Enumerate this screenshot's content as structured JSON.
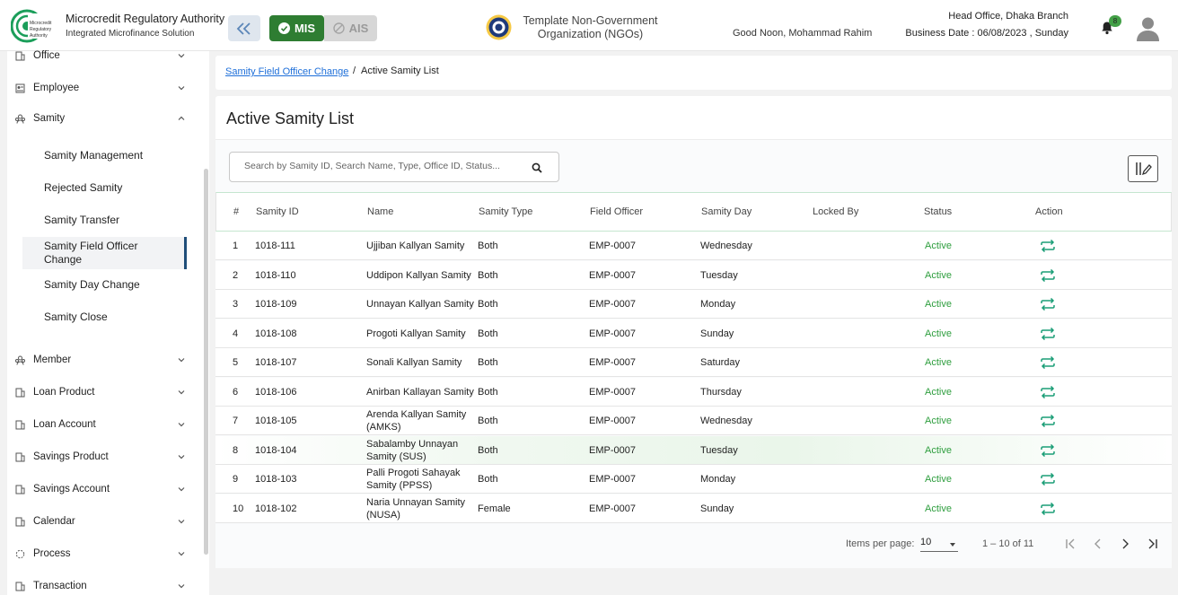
{
  "header": {
    "app_title": "Microcredit Regulatory Authority",
    "app_subtitle": "Integrated Microfinance Solution",
    "mis_label": "MIS",
    "ais_label": "AIS",
    "org_name": "Template Non-Government Organization (NGOs)",
    "greeting": "Good Noon, Mohammad Rahim",
    "branch": "Head Office, Dhaka Branch",
    "business_date": "Business Date : 06/08/2023 , Sunday",
    "notification_count": "8"
  },
  "sidebar": {
    "items": [
      {
        "label": "Office",
        "icon": "office-icon"
      },
      {
        "label": "Employee",
        "icon": "employee-icon"
      },
      {
        "label": "Samity",
        "icon": "samity-icon",
        "expanded": true
      },
      {
        "label": "Member",
        "icon": "member-icon"
      },
      {
        "label": "Loan Product",
        "icon": "loan-product-icon"
      },
      {
        "label": "Loan Account",
        "icon": "loan-account-icon"
      },
      {
        "label": "Savings Product",
        "icon": "savings-product-icon"
      },
      {
        "label": "Savings Account",
        "icon": "savings-account-icon"
      },
      {
        "label": "Calendar",
        "icon": "calendar-icon"
      },
      {
        "label": "Process",
        "icon": "process-icon"
      },
      {
        "label": "Transaction",
        "icon": "transaction-icon"
      }
    ],
    "samity_sub": [
      {
        "label": "Samity Management"
      },
      {
        "label": "Rejected Samity"
      },
      {
        "label": "Samity Transfer"
      },
      {
        "label": "Samity Field Officer Change",
        "active": true
      },
      {
        "label": "Samity Day Change"
      },
      {
        "label": "Samity Close"
      }
    ]
  },
  "breadcrumb": {
    "link": "Samity Field Officer Change",
    "separator": "/",
    "current": "Active Samity List"
  },
  "page": {
    "title": "Active Samity List",
    "search_placeholder": "Search by Samity ID, Search Name, Type, Office ID, Status..."
  },
  "table": {
    "headers": [
      "#",
      "Samity ID",
      "Name",
      "Samity Type",
      "Field Officer",
      "Samity Day",
      "Locked By",
      "Status",
      "Action"
    ],
    "rows": [
      {
        "n": "1",
        "id": "1018-111",
        "name": "Ujjiban Kallyan Samity",
        "type": "Both",
        "officer": "EMP-0007",
        "day": "Wednesday",
        "locked": "",
        "status": "Active"
      },
      {
        "n": "2",
        "id": "1018-110",
        "name": "Uddipon Kallyan Samity",
        "type": "Both",
        "officer": "EMP-0007",
        "day": "Tuesday",
        "locked": "",
        "status": "Active"
      },
      {
        "n": "3",
        "id": "1018-109",
        "name": "Unnayan Kallyan Samity",
        "type": "Both",
        "officer": "EMP-0007",
        "day": "Monday",
        "locked": "",
        "status": "Active"
      },
      {
        "n": "4",
        "id": "1018-108",
        "name": "Progoti Kallyan Samity",
        "type": "Both",
        "officer": "EMP-0007",
        "day": "Sunday",
        "locked": "",
        "status": "Active"
      },
      {
        "n": "5",
        "id": "1018-107",
        "name": "Sonali Kallyan Samity",
        "type": "Both",
        "officer": "EMP-0007",
        "day": "Saturday",
        "locked": "",
        "status": "Active"
      },
      {
        "n": "6",
        "id": "1018-106",
        "name": "Anirban Kallayan Samity",
        "type": "Both",
        "officer": "EMP-0007",
        "day": "Thursday",
        "locked": "",
        "status": "Active"
      },
      {
        "n": "7",
        "id": "1018-105",
        "name": "Arenda Kallyan Samity (AMKS)",
        "type": "Both",
        "officer": "EMP-0007",
        "day": "Wednesday",
        "locked": "",
        "status": "Active"
      },
      {
        "n": "8",
        "id": "1018-104",
        "name": "Sabalamby Unnayan Samity (SUS)",
        "type": "Both",
        "officer": "EMP-0007",
        "day": "Tuesday",
        "locked": "",
        "status": "Active"
      },
      {
        "n": "9",
        "id": "1018-103",
        "name": "Palli Progoti Sahayak Samity (PPSS)",
        "type": "Both",
        "officer": "EMP-0007",
        "day": "Monday",
        "locked": "",
        "status": "Active"
      },
      {
        "n": "10",
        "id": "1018-102",
        "name": "Naria Unnayan Samity (NUSA)",
        "type": "Female",
        "officer": "EMP-0007",
        "day": "Sunday",
        "locked": "",
        "status": "Active"
      }
    ]
  },
  "pagination": {
    "items_per_page_label": "Items per page:",
    "items_per_page": "10",
    "range": "1 – 10 of 11"
  },
  "colors": {
    "accent_green": "#2e7d32",
    "status_green": "#2e9e3e",
    "action_teal": "#1b9e77",
    "link_blue": "#1e6fd9"
  }
}
